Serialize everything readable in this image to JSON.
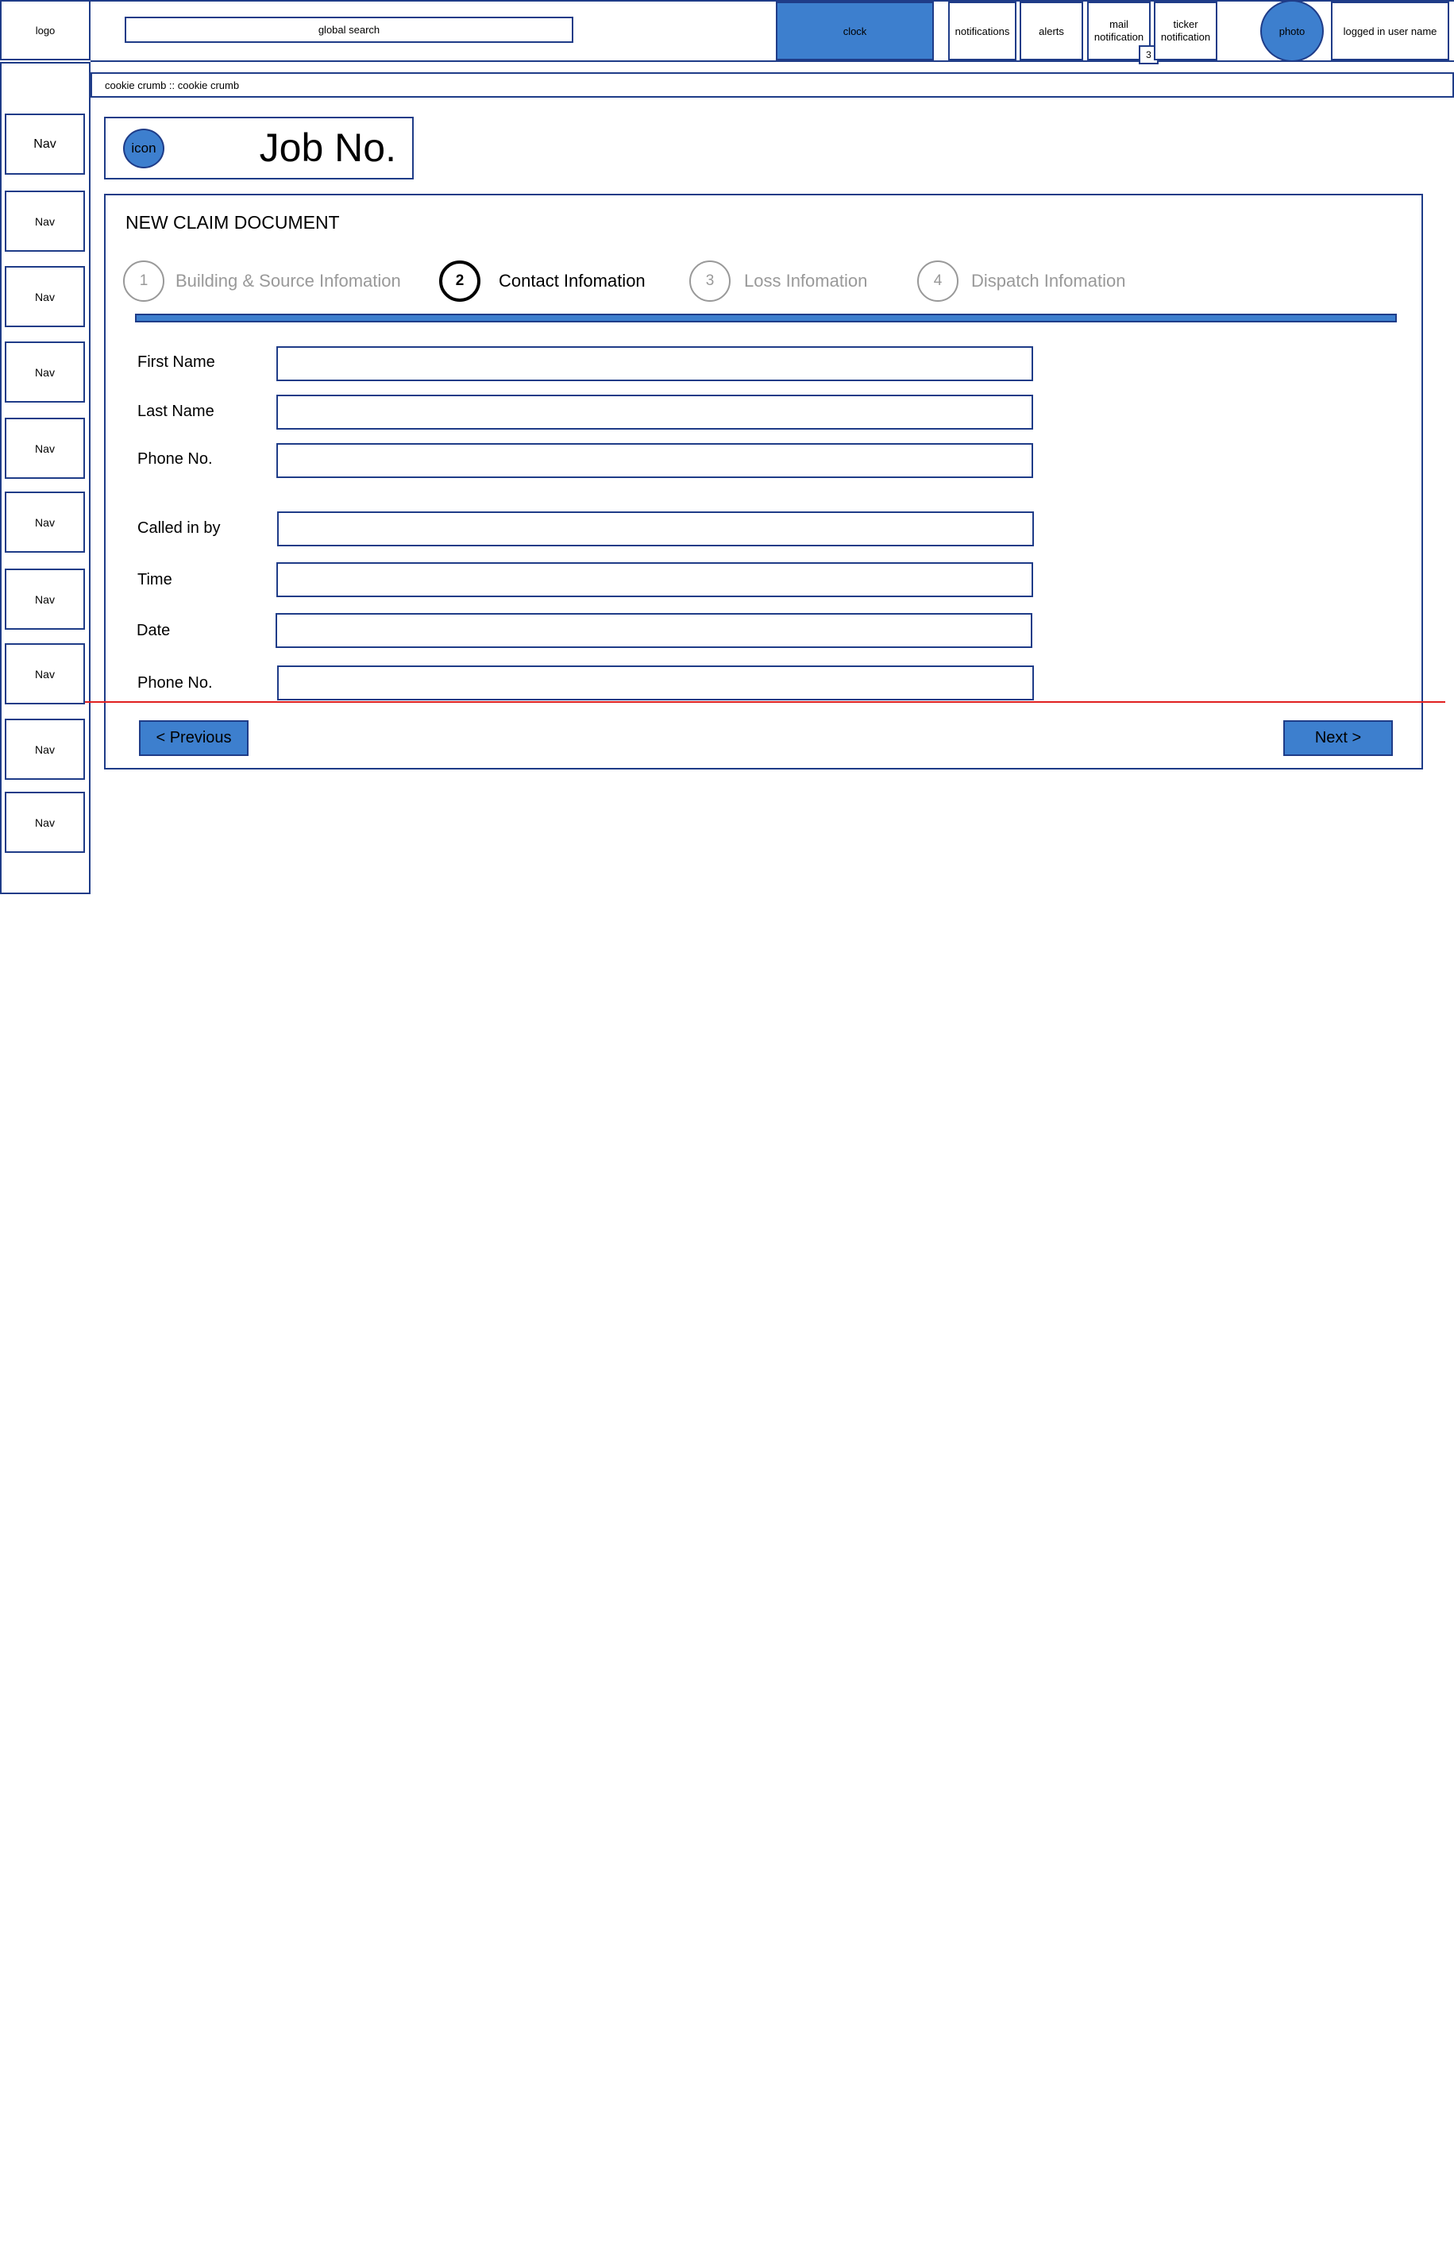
{
  "header": {
    "logo": "logo",
    "search_label": "global search",
    "clock": "clock",
    "notifications": "notifications",
    "alerts": "alerts",
    "mail_line1": "mail",
    "mail_line2": "notification",
    "mail_count": "3",
    "ticker_line1": "ticker",
    "ticker_line2": "notification",
    "photo": "photo",
    "user_name": "logged in user name"
  },
  "breadcrumb": "cookie crumb :: cookie crumb",
  "sidebar": {
    "items": [
      "Nav",
      "Nav",
      "Nav",
      "Nav",
      "Nav",
      "Nav",
      "Nav",
      "Nav",
      "Nav",
      "Nav"
    ]
  },
  "job": {
    "icon_label": "icon",
    "title": "Job No."
  },
  "form": {
    "title": "NEW CLAIM DOCUMENT",
    "steps": [
      {
        "number": "1",
        "label": "Building & Source Infomation"
      },
      {
        "number": "2",
        "label": "Contact Infomation"
      },
      {
        "number": "3",
        "label": "Loss Infomation"
      },
      {
        "number": "4",
        "label": "Dispatch Infomation"
      }
    ],
    "active_step": 2,
    "fields": [
      {
        "label": "First Name",
        "value": ""
      },
      {
        "label": "Last Name",
        "value": ""
      },
      {
        "label": "Phone No.",
        "value": ""
      },
      {
        "label": "Called in by",
        "value": ""
      },
      {
        "label": "Time",
        "value": ""
      },
      {
        "label": "Date",
        "value": ""
      },
      {
        "label": "Phone No.",
        "value": ""
      }
    ],
    "previous_label": "< Previous",
    "next_label": "Next >"
  },
  "colors": {
    "accent": "#3d7fce",
    "border": "#1f3c88",
    "guide_line": "#e02020"
  }
}
